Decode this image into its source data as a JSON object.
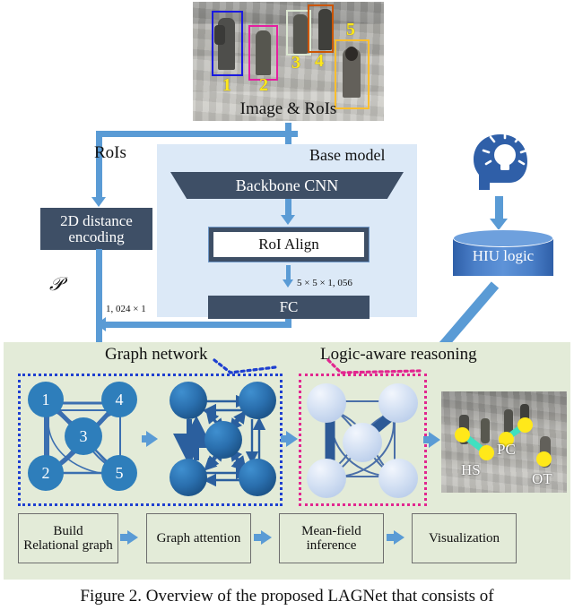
{
  "figure": {
    "caption": "Figure 2.  Overview  of  the  proposed  LAGNet  that  consists  of"
  },
  "top_image": {
    "caption": "Image & RoIs",
    "roi_numbers": [
      "1",
      "2",
      "3",
      "4",
      "5"
    ],
    "roi_colors": [
      "#1a1ae0",
      "#e51fa0",
      "#dce8d2",
      "#cc5500",
      "#ffbf2e"
    ]
  },
  "base_model": {
    "title": "Base model",
    "backbone_label": "Backbone CNN",
    "roi_align_label": "RoI Align",
    "fc_label": "FC",
    "tensor_label": "5 × 5 × 1, 056",
    "panel_color": "#dce9f7",
    "box_color": "#3e4f66"
  },
  "left_branch": {
    "rois_label": "RoIs",
    "distance_encoding_label_line1": "2D distance",
    "distance_encoding_label_line2": "encoding",
    "p_symbol": "𝒫",
    "feature_dim_label": "1, 024 × 1"
  },
  "knowledge": {
    "brain_icon": "head-lightbulb-icon",
    "cylinder_label": "HIU logic",
    "cylinder_color": "#4a7fc8"
  },
  "graph_network": {
    "title": "Graph network",
    "border_color": "#1e3fd0",
    "node_labels": [
      "1",
      "4",
      "3",
      "2",
      "5"
    ]
  },
  "logic_reasoning": {
    "title": "Logic-aware reasoning",
    "border_color": "#e2268f"
  },
  "visualization": {
    "labels": [
      "HS",
      "PC",
      "OT"
    ],
    "dot_color": "#ffe81a",
    "edge_color": "#3fe0c0"
  },
  "pipeline": {
    "steps": [
      {
        "line1": "Build",
        "line2": "Relational graph"
      },
      {
        "line1": "Graph attention",
        "line2": ""
      },
      {
        "line1": "Mean-field",
        "line2": "inference"
      },
      {
        "line1": "Visualization",
        "line2": ""
      }
    ]
  },
  "icons": {
    "arrow_down": "arrow-down-icon",
    "arrow_right": "arrow-right-icon",
    "arrow_left": "arrow-left-icon"
  }
}
